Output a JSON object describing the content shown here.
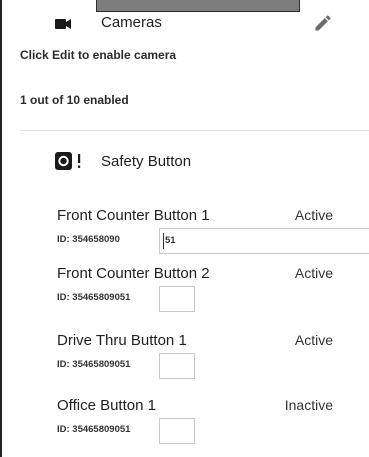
{
  "cameras": {
    "title": "Cameras",
    "icon": "video-camera-icon",
    "edit_icon": "pencil-icon",
    "hint": "Click Edit to enable camera",
    "enabled_count": "1 out of 10 enabled"
  },
  "safety": {
    "title": "Safety Button",
    "icon": "safety-button-icon",
    "buttons": [
      {
        "name": "Front Counter Button 1",
        "status": "Active",
        "id_label": "ID: 354658090",
        "id_value": "51"
      },
      {
        "name": "Front Counter Button 2",
        "status": "Active",
        "id_label": "ID: 35465809051",
        "id_value": ""
      },
      {
        "name": "Drive Thru Button 1",
        "status": "Active",
        "id_label": "ID: 35465809051",
        "id_value": ""
      },
      {
        "name": "Office Button 1",
        "status": "Inactive",
        "id_label": "ID: 35465809051",
        "id_value": ""
      }
    ]
  },
  "colors": {
    "tab": "#7d7d7d",
    "divider": "#e2e2e2",
    "text": "#212121"
  }
}
